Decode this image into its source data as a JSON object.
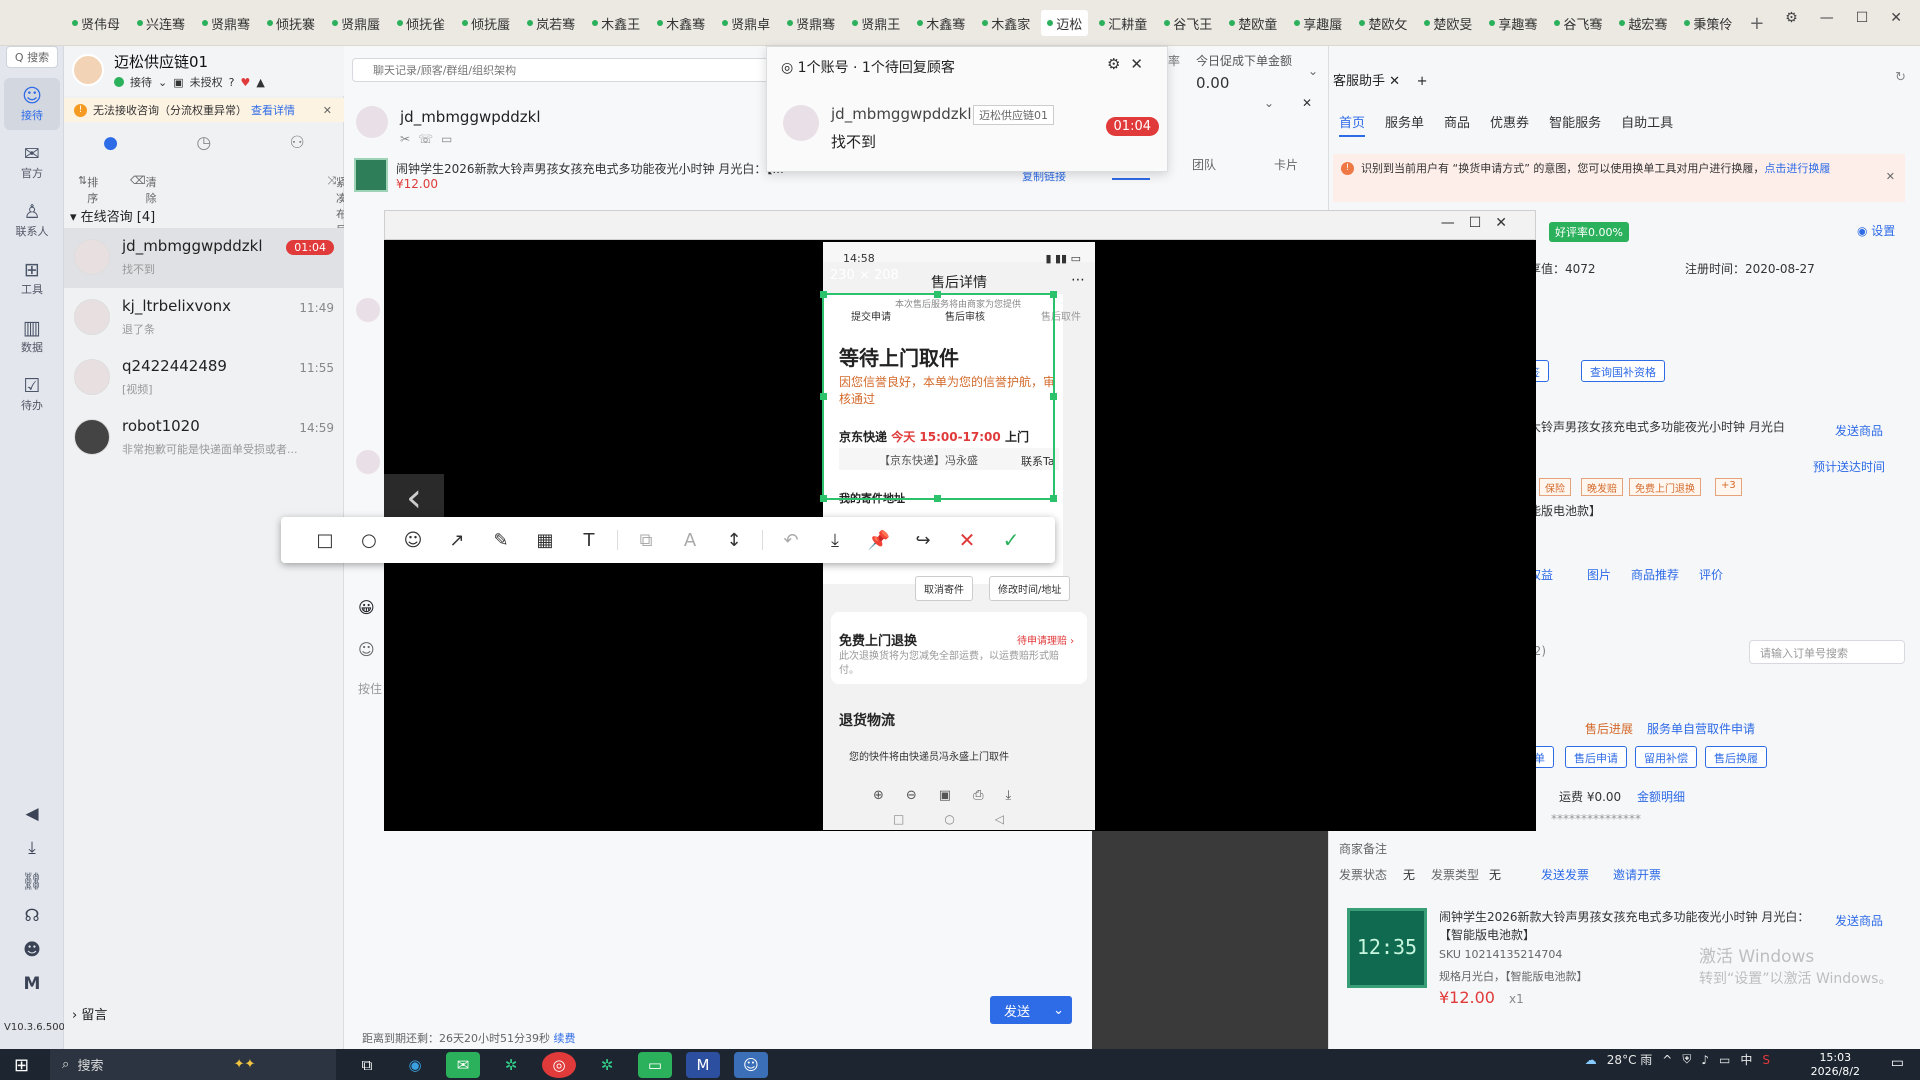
{
  "topbar": {
    "tabs": [
      "贤伟母",
      "兴连骞",
      "贤鼎骞",
      "倾抚褰",
      "贤鼎蜃",
      "倾抚雀",
      "倾抚蜃",
      "岚若骞",
      "木鑫王",
      "木鑫骞",
      "贤鼎卓",
      "贤鼎骞",
      "贤鼎王",
      "木鑫骞",
      "木鑫家",
      "迈松",
      "汇耕童",
      "谷飞王",
      "楚欧童",
      "享趣蜃",
      "楚欧攵",
      "楚欧旻",
      "享趣骞",
      "谷飞骞",
      "越宏骞",
      "秉策伶"
    ],
    "active_tab": "迈松",
    "add": "+",
    "min": "—",
    "max": "☐",
    "close": "✕"
  },
  "leftnav": {
    "search": "Q 搜索",
    "items": [
      {
        "icon": "☺",
        "label": "接待"
      },
      {
        "icon": "✉",
        "label": "官方"
      },
      {
        "icon": "♙",
        "label": "联系人"
      },
      {
        "icon": "⊞",
        "label": "工具"
      },
      {
        "icon": "▥",
        "label": "数据"
      },
      {
        "icon": "☑",
        "label": "待办"
      }
    ],
    "bottom_icons": [
      "◀",
      "⤓",
      "⛓",
      "☊",
      "☻",
      "M"
    ],
    "version": "V10.3.6.500"
  },
  "store": {
    "name": "迈松供应链01",
    "status": "接待",
    "auth": "未授权",
    "warning": "无法接收咨询（分流权重异常）",
    "warning_link": "查看详情",
    "sort": "排序",
    "clear": "清除",
    "layout": "紧凑布局",
    "group": "在线咨询 [4]",
    "leave": "留言"
  },
  "conversations": [
    {
      "name": "jd_mbmggwpddzkl",
      "msg": "找不到",
      "time": "01:04",
      "badge": true
    },
    {
      "name": "kj_ltrbelixvonx",
      "msg": "退了条",
      "time": "11:49",
      "badge": false
    },
    {
      "name": "q2422442489",
      "msg": "[视频]",
      "time": "11:55",
      "badge": false
    },
    {
      "name": "robot1020",
      "msg": "非常抱歉可能是快递面单受损或者...",
      "time": "14:59",
      "badge": false
    }
  ],
  "chat": {
    "search_placeholder": "聊天记录/顾客/群组/组织架构",
    "customer": "jd_mbmggwpddzkl",
    "product_title": "闹钟学生2026新款大铃声男孩女孩充电式多功能夜光小时钟 月光白：【...",
    "product_price": "¥12.00",
    "copy_link": "复制链接",
    "input_hint": "按住",
    "send": "发送",
    "send_arrow": "⌄",
    "footer": "距离到期还剩：26天20小时51分39秒",
    "footer_link": "续费"
  },
  "middle": {
    "rate_label": "率",
    "today_label": "今日促成下单金额",
    "today_value": "0.00",
    "team": "团队",
    "card": "卡片"
  },
  "notification": {
    "header": "1个账号 · 1个待回复顾客",
    "name": "jd_mbmggwpddzkl",
    "store": "迈松供应链01",
    "message": "找不到",
    "badge": "01:04"
  },
  "helper": {
    "tab": "客服助手",
    "nav": [
      "首页",
      "服务单",
      "商品",
      "优惠券",
      "智能服务",
      "自助工具"
    ],
    "tip": "识别到当前用户有 “换货申请方式” 的意图，您可以使用换单工具对用户进行换履，",
    "tip_link": "点击进行换履",
    "good_rate": "好评率0.00%",
    "settings": "设置",
    "score_label": "享值：",
    "score": "4072",
    "reg_label": "注册时间：",
    "reg_date": "2020-08-27",
    "btn_tag": "标签",
    "btn_subsidy": "查询国补资格",
    "product_line": "大铃声男孩女孩充电式多功能夜光小时钟 月光白",
    "send_product": "发送商品",
    "estimate": "预计送达时间",
    "chips": [
      "保险",
      "晚发赔",
      "免费上门退换",
      "+3"
    ],
    "battery": "能版电池款】",
    "links": [
      "权益",
      "图片",
      "商品推荐",
      "评价"
    ],
    "order_search": "请输入订单号搜索",
    "orders_label": "(2)",
    "after_sales": "售后进展",
    "after_sales_detail": "服务单自营取件申请",
    "order_btns": [
      "单",
      "售后申请",
      "留用补偿",
      "售后换履"
    ],
    "amount": "运费 ¥0.00",
    "amount_link": "金额明细",
    "masked": "***************",
    "remark_label": "商家备注",
    "invoice_status": "发票状态",
    "invoice_status_val": "无",
    "invoice_type": "发票类型",
    "invoice_type_val": "无",
    "invoice_send": "发送发票",
    "invoice_invite": "邀请开票",
    "p_title": "闹钟学生2026新款大铃声男孩女孩充电式多功能夜光小时钟 月光白：【智能版电池款】",
    "p_send": "发送商品",
    "p_sku": "SKU 10214135214704",
    "p_spec": "规格月光白，【智能版电池款】",
    "p_price": "¥12.00",
    "p_qty": "x1",
    "p_img": "12:35",
    "activate_1": "激活 Windows",
    "activate_2": "转到“设置”以激活 Windows。"
  },
  "viewer": {
    "size_label": "230 × 208",
    "prev": "‹",
    "phone": {
      "time": "14:58",
      "title": "售后详情",
      "note": "本次售后服务将由商家为您提供",
      "steps": [
        "提交申请",
        "售后审核",
        "售后取件"
      ],
      "status": "等待上门取件",
      "desc": "因您信誉良好，本单为您的信誉护航，审核通过",
      "courier": "京东快递",
      "today": "今天 15:00-17:00",
      "door": "上门",
      "courier_person": "【京东快递】冯永盛",
      "contact": "联系Ta",
      "address": "我的寄件地址",
      "cancel": "取消寄件",
      "modify": "修改时间/地址",
      "free_return": "免费上门退换",
      "pending": "待申请理赔 ›",
      "free_desc": "此次退换货将为您减免全部运费，以运费赔形式赔付。",
      "logistics": "退货物流",
      "logistics_desc": "您的快件将由快递员冯永盛上门取件"
    }
  },
  "toolbar": {
    "icons": [
      "□",
      "○",
      "☺",
      "↗",
      "✎",
      "▦",
      "T",
      "⧉",
      "A",
      "↕",
      "↶",
      "⤓",
      "📌",
      "↪",
      "✕",
      "✓"
    ]
  },
  "taskbar": {
    "search": "搜索",
    "weather": "28°C 雨",
    "time": "15:03",
    "date": "2026/8/2",
    "ime": "中"
  }
}
